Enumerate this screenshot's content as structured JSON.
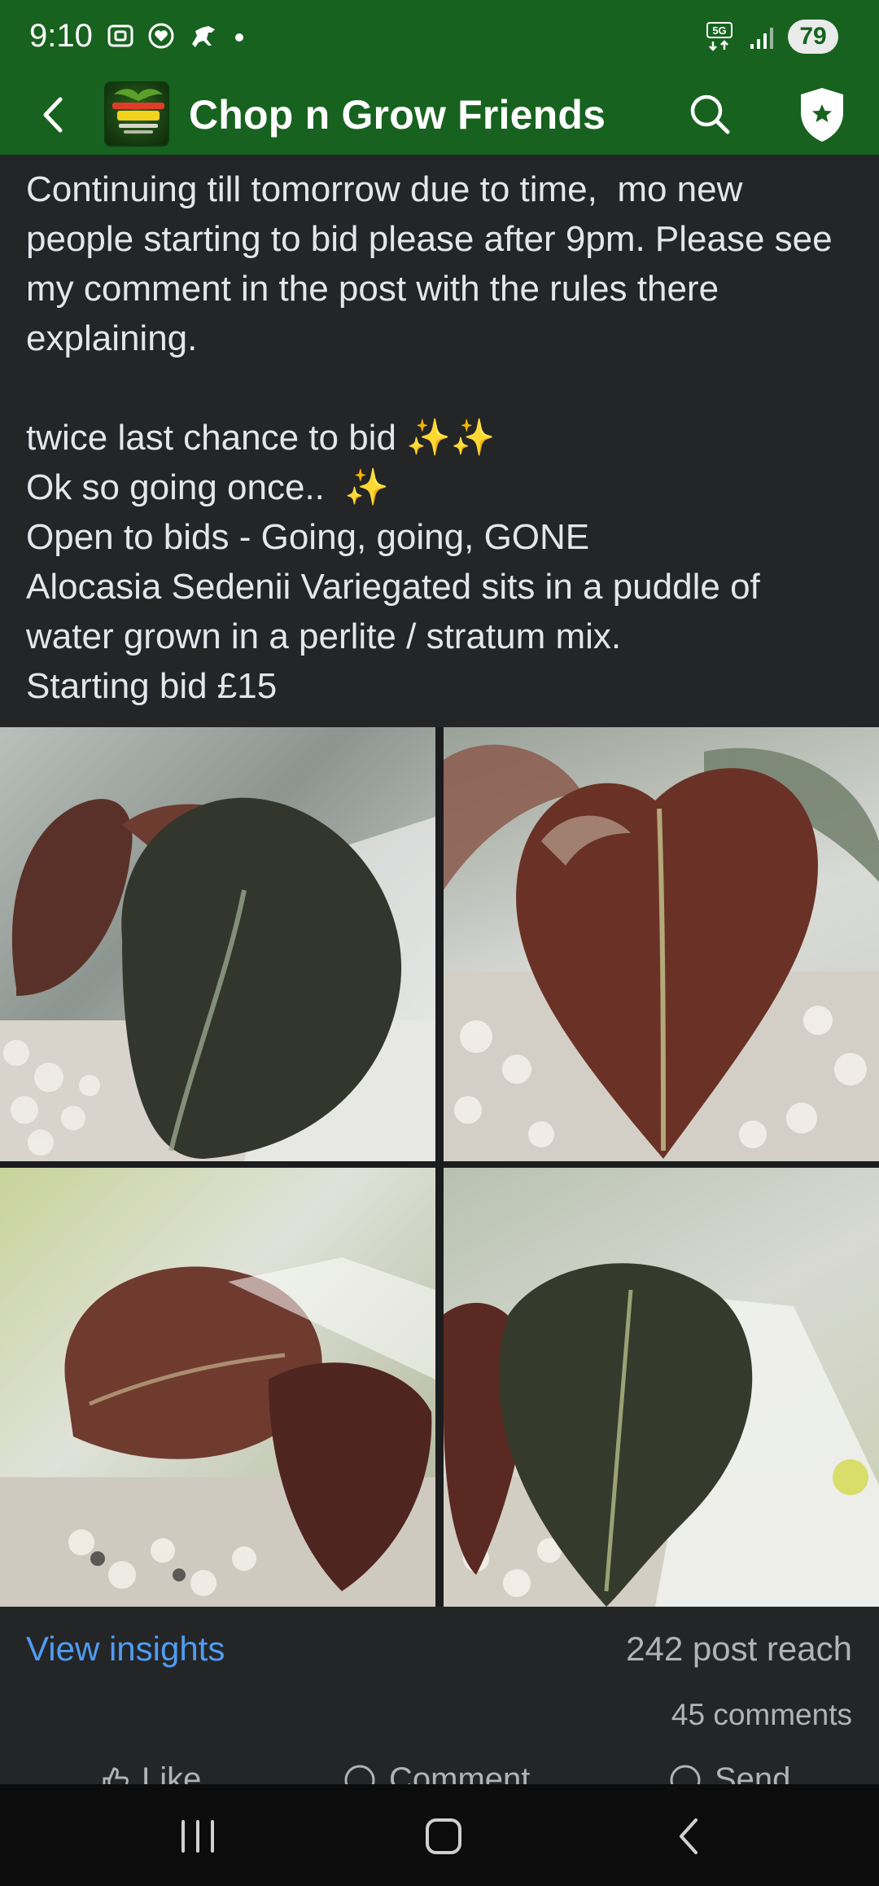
{
  "status_bar": {
    "time": "9:10",
    "network": "5G",
    "battery": "79"
  },
  "app_bar": {
    "group_name": "Chop n Grow Friends",
    "logo_text": "Chop N Grow Friends"
  },
  "post": {
    "paragraph1": "Continuing till tomorrow due to time,  mo new people starting to bid please after 9pm. Please see my comment in the post with the rules there explaining.",
    "line_twice": "twice last chance to bid ✨✨",
    "line_once": "Ok so going once..  ✨",
    "line_open": "Open to bids - Going, going, GONE",
    "line_desc": "Alocasia Sedenii Variegated sits in a puddle of water grown in a perlite / stratum mix.",
    "line_start": "Starting bid £15"
  },
  "insights": {
    "view_label": "View insights",
    "reach": "242 post reach",
    "comments": "45 comments"
  },
  "actions": {
    "like": "Like",
    "comment": "Comment",
    "send": "Send"
  },
  "colors": {
    "brand_green": "#17621f",
    "background": "#242527",
    "link_blue": "#4f9cf0"
  }
}
